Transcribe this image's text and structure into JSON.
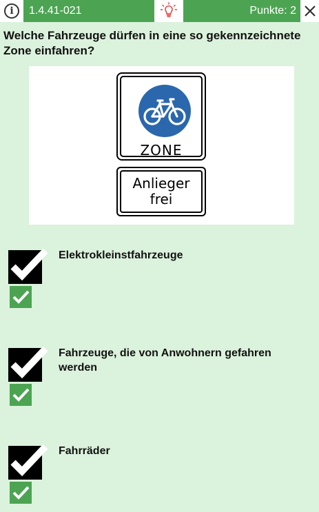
{
  "header": {
    "question_id": "1.4.41-021",
    "points": "Punkte: 2",
    "info_icon": "info-icon",
    "hint_icon": "lightbulb-icon",
    "close_icon": "close-icon",
    "accent_color": "#4ca452",
    "hint_color": "#e53935"
  },
  "question": {
    "text": "Welche Fahrzeuge dürfen in eine so gekennzeichnete Zone einfahren?"
  },
  "sign": {
    "main_label": "ZONE",
    "sub_line1": "Anlieger",
    "sub_line2": "frei",
    "symbol": "bicycle-icon",
    "circle_color": "#2a67ad"
  },
  "answers": [
    {
      "text": "Elektrokleinstfahrzeuge",
      "checked": true,
      "correct": true
    },
    {
      "text": "Fahrzeuge, die von Anwohnern gefahren werden",
      "checked": true,
      "correct": true
    },
    {
      "text": "Fahrräder",
      "checked": true,
      "correct": true
    }
  ]
}
